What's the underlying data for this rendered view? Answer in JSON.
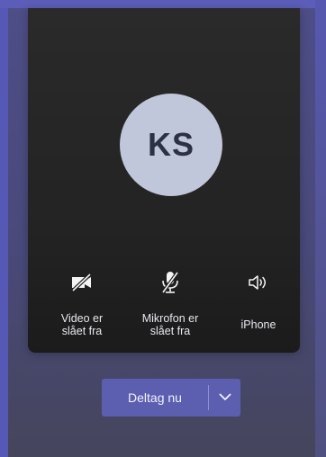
{
  "avatar": {
    "initials": "KS"
  },
  "controls": {
    "video": {
      "label": "Video er\nslået fra",
      "icon": "video-off-icon",
      "state": "off"
    },
    "mic": {
      "label": "Mikrofon er\nslået fra",
      "icon": "mic-off-icon",
      "state": "off"
    },
    "speaker": {
      "label": "iPhone",
      "icon": "speaker-icon"
    }
  },
  "join": {
    "label": "Deltag nu",
    "dropdown_icon": "chevron-down-icon"
  },
  "colors": {
    "accent": "#5c5fb0",
    "card": "#262626",
    "avatar_bg": "#c1c7da"
  }
}
